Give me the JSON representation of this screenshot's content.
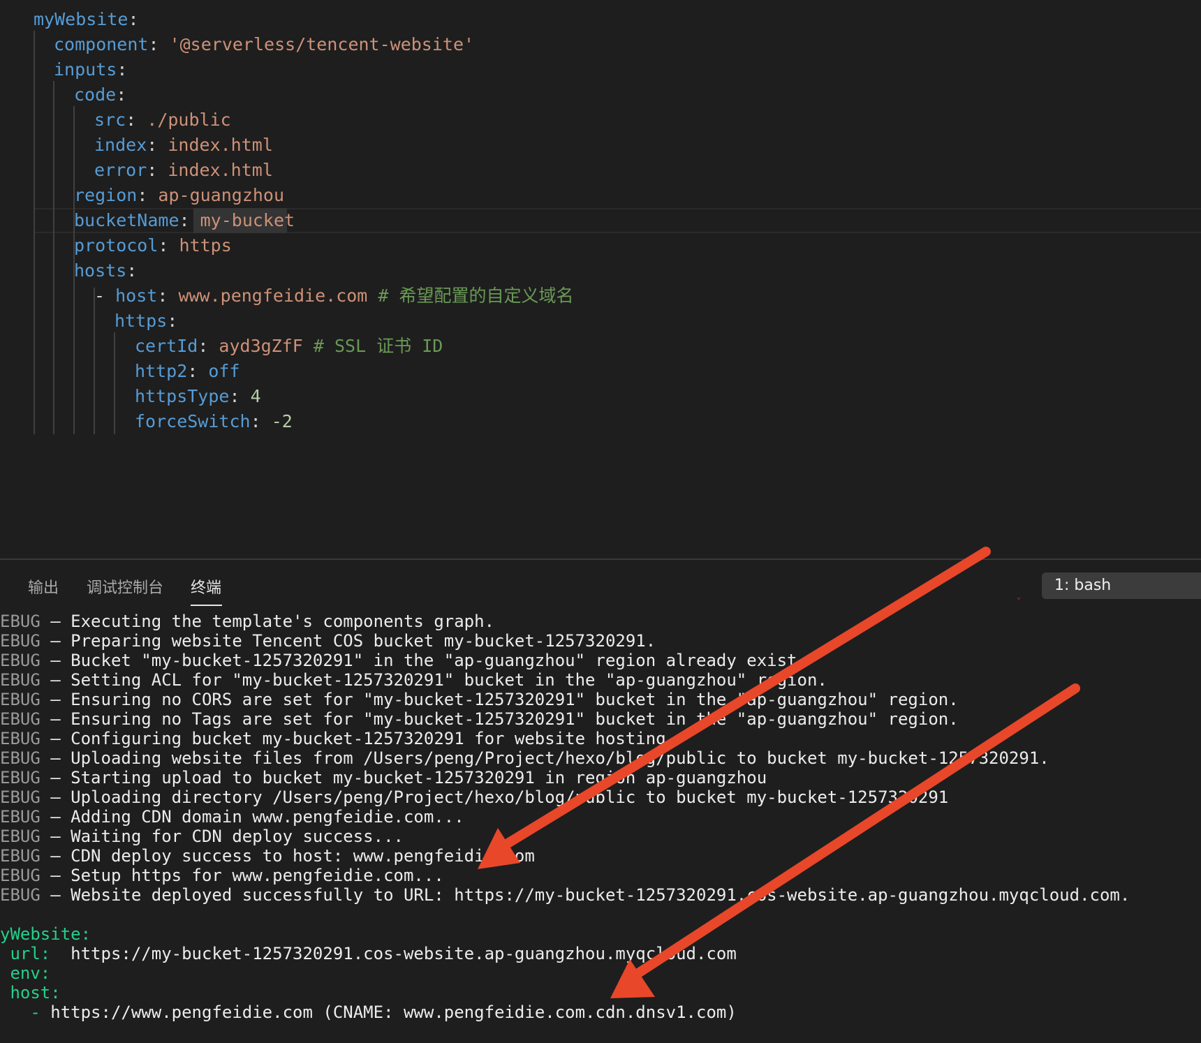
{
  "editor": {
    "lines": [
      [
        {
          "t": "myWebsite",
          "c": "k"
        },
        {
          "t": ":",
          "c": "p"
        }
      ],
      [
        {
          "t": "component",
          "c": "k"
        },
        {
          "t": ": ",
          "c": "p"
        },
        {
          "t": "'@serverless/tencent-website'",
          "c": "s"
        }
      ],
      [
        {
          "t": "inputs",
          "c": "k"
        },
        {
          "t": ":",
          "c": "p"
        }
      ],
      [
        {
          "t": "code",
          "c": "k"
        },
        {
          "t": ":",
          "c": "p"
        }
      ],
      [
        {
          "t": "src",
          "c": "k"
        },
        {
          "t": ": ",
          "c": "p"
        },
        {
          "t": "./public",
          "c": "s"
        }
      ],
      [
        {
          "t": "index",
          "c": "k"
        },
        {
          "t": ": ",
          "c": "p"
        },
        {
          "t": "index.html",
          "c": "s"
        }
      ],
      [
        {
          "t": "error",
          "c": "k"
        },
        {
          "t": ": ",
          "c": "p"
        },
        {
          "t": "index.html",
          "c": "s"
        }
      ],
      [
        {
          "t": "region",
          "c": "k"
        },
        {
          "t": ": ",
          "c": "p"
        },
        {
          "t": "ap-guangzhou",
          "c": "s"
        }
      ],
      [
        {
          "t": "bucketName",
          "c": "k"
        },
        {
          "t": ": ",
          "c": "p"
        },
        {
          "t": "my-bucket",
          "c": "s"
        }
      ],
      [
        {
          "t": "protocol",
          "c": "k"
        },
        {
          "t": ": ",
          "c": "p"
        },
        {
          "t": "https",
          "c": "s"
        }
      ],
      [
        {
          "t": "hosts",
          "c": "k"
        },
        {
          "t": ":",
          "c": "p"
        }
      ],
      [
        {
          "t": "- ",
          "c": "p"
        },
        {
          "t": "host",
          "c": "k"
        },
        {
          "t": ": ",
          "c": "p"
        },
        {
          "t": "www.pengfeidie.com",
          "c": "s"
        },
        {
          "t": " # 希望配置的自定义域名",
          "c": "c"
        }
      ],
      [
        {
          "t": "https",
          "c": "k"
        },
        {
          "t": ":",
          "c": "p"
        }
      ],
      [
        {
          "t": "certId",
          "c": "k"
        },
        {
          "t": ": ",
          "c": "p"
        },
        {
          "t": "ayd3gZfF",
          "c": "s"
        },
        {
          "t": " # SSL 证书 ID",
          "c": "c"
        }
      ],
      [
        {
          "t": "http2",
          "c": "k"
        },
        {
          "t": ": ",
          "c": "p"
        },
        {
          "t": "off",
          "c": "k"
        }
      ],
      [
        {
          "t": "httpsType",
          "c": "k"
        },
        {
          "t": ": ",
          "c": "p"
        },
        {
          "t": "4",
          "c": "n"
        }
      ],
      [
        {
          "t": "forceSwitch",
          "c": "k"
        },
        {
          "t": ": ",
          "c": "p"
        },
        {
          "t": "-2",
          "c": "n"
        }
      ]
    ]
  },
  "panel": {
    "tabs": [
      "输出",
      "调试控制台",
      "终端"
    ],
    "active_tab": "终端",
    "terminal_selector": "1: bash",
    "lines": [
      [
        {
          "t": "EBUG",
          "c": "dbg"
        },
        {
          "t": " — Executing the template's components graph.",
          "c": ""
        }
      ],
      [
        {
          "t": "EBUG",
          "c": "dbg"
        },
        {
          "t": " — Preparing website Tencent COS bucket my-bucket-1257320291.",
          "c": ""
        }
      ],
      [
        {
          "t": "EBUG",
          "c": "dbg"
        },
        {
          "t": " — Bucket \"my-bucket-1257320291\" in the \"ap-guangzhou\" region already exist.",
          "c": ""
        }
      ],
      [
        {
          "t": "EBUG",
          "c": "dbg"
        },
        {
          "t": " — Setting ACL for \"my-bucket-1257320291\" bucket in the \"ap-guangzhou\" region.",
          "c": ""
        }
      ],
      [
        {
          "t": "EBUG",
          "c": "dbg"
        },
        {
          "t": " — Ensuring no CORS are set for \"my-bucket-1257320291\" bucket in the \"ap-guangzhou\" region.",
          "c": ""
        }
      ],
      [
        {
          "t": "EBUG",
          "c": "dbg"
        },
        {
          "t": " — Ensuring no Tags are set for \"my-bucket-1257320291\" bucket in the \"ap-guangzhou\" region.",
          "c": ""
        }
      ],
      [
        {
          "t": "EBUG",
          "c": "dbg"
        },
        {
          "t": " — Configuring bucket my-bucket-1257320291 for website hosting.",
          "c": ""
        }
      ],
      [
        {
          "t": "EBUG",
          "c": "dbg"
        },
        {
          "t": " — Uploading website files from /Users/peng/Project/hexo/blog/public to bucket my-bucket-1257320291.",
          "c": ""
        }
      ],
      [
        {
          "t": "EBUG",
          "c": "dbg"
        },
        {
          "t": " — Starting upload to bucket my-bucket-1257320291 in region ap-guangzhou",
          "c": ""
        }
      ],
      [
        {
          "t": "EBUG",
          "c": "dbg"
        },
        {
          "t": " — Uploading directory /Users/peng/Project/hexo/blog/public to bucket my-bucket-1257320291",
          "c": ""
        }
      ],
      [
        {
          "t": "EBUG",
          "c": "dbg"
        },
        {
          "t": " — Adding CDN domain www.pengfeidie.com...",
          "c": ""
        }
      ],
      [
        {
          "t": "EBUG",
          "c": "dbg"
        },
        {
          "t": " — Waiting for CDN deploy success...",
          "c": ""
        }
      ],
      [
        {
          "t": "EBUG",
          "c": "dbg"
        },
        {
          "t": " — CDN deploy success to host: www.pengfeidie.com",
          "c": ""
        }
      ],
      [
        {
          "t": "EBUG",
          "c": "dbg"
        },
        {
          "t": " — Setup https for www.pengfeidie.com...",
          "c": ""
        }
      ],
      [
        {
          "t": "EBUG",
          "c": "dbg"
        },
        {
          "t": " — Website deployed successfully to URL: https://my-bucket-1257320291.cos-website.ap-guangzhou.myqcloud.com.",
          "c": ""
        }
      ],
      [],
      [
        {
          "t": "yWebsite:",
          "c": "grn"
        }
      ],
      [
        {
          "t": " url:",
          "c": "grn"
        },
        {
          "t": "  https://my-bucket-1257320291.cos-website.ap-guangzhou.myqcloud.com",
          "c": ""
        }
      ],
      [
        {
          "t": " env:",
          "c": "grn"
        }
      ],
      [
        {
          "t": " host:",
          "c": "grn"
        }
      ],
      [
        {
          "t": "   - ",
          "c": "grn"
        },
        {
          "t": "https://www.pengfeidie.com (CNAME: www.pengfeidie.com.cdn.dnsv1.com)",
          "c": ""
        }
      ]
    ]
  },
  "colors": {
    "annotation_arrow": "#e8472a",
    "background": "#1e1e1e",
    "yaml_key": "#569cd6",
    "yaml_string": "#ce9178",
    "comment": "#6a9955",
    "number": "#b5cea8",
    "terminal_green": "#23d18b"
  }
}
